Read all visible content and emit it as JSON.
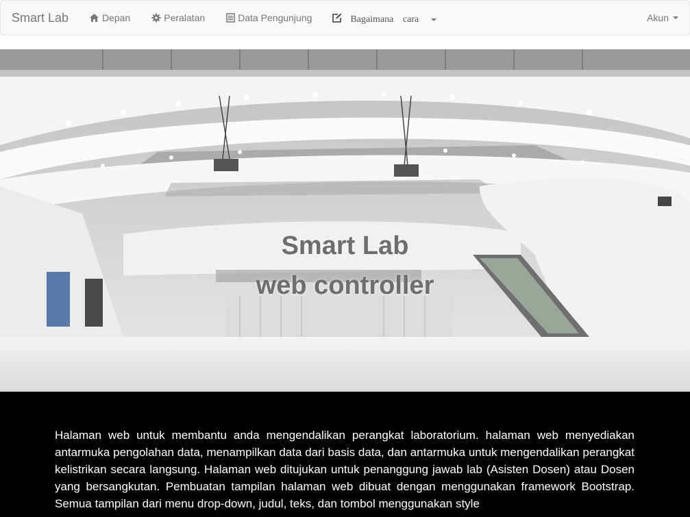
{
  "navbar": {
    "brand": "Smart Lab",
    "items": [
      {
        "label": "Depan",
        "icon": "home-icon"
      },
      {
        "label": "Peralatan",
        "icon": "gear-icon"
      },
      {
        "label": "Data Pengunjung",
        "icon": "list-icon"
      }
    ],
    "how_to": {
      "label": "Bagaimana cara",
      "icon": "edit-icon"
    },
    "account": "Akun"
  },
  "hero": {
    "title_line1": "Smart Lab",
    "title_line2": "web controller"
  },
  "content": {
    "description": "Halaman web untuk membantu anda mengendalikan perangkat laboratorium. halaman web menyediakan antarmuka pengolahan data, menampilkan data dari basis data, dan antarmuka untuk mengendalikan perangkat kelistrikan secara langsung. Halaman web ditujukan untuk penanggung jawab lab (Asisten Dosen) atau Dosen yang bersangkutan. Pembuatan tampilan halaman web dibuat dengan menggunakan framework Bootstrap. Semua tampilan dari menu drop-down, judul, teks, dan tombol menggunakan style"
  },
  "colors": {
    "navbar_bg": "#f8f8f8",
    "nav_text": "#777777",
    "hero_title": "#6e6e6e",
    "content_bg": "#000000",
    "content_text": "#ffffff"
  }
}
